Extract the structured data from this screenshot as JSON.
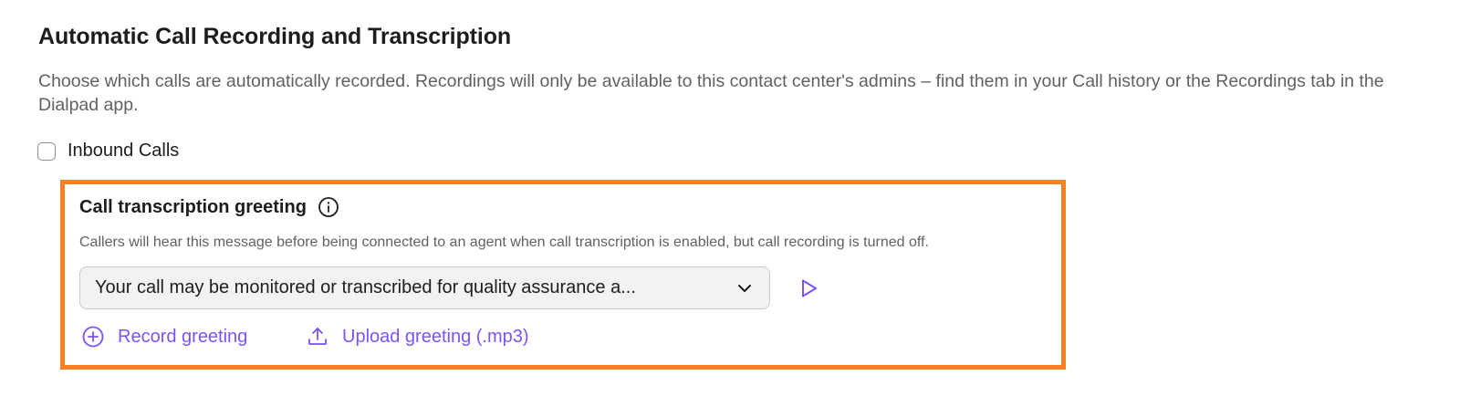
{
  "section": {
    "title": "Automatic Call Recording and Transcription",
    "description": "Choose which calls are automatically recorded. Recordings will only be available to this contact center's admins – find them in your Call history or the Recordings tab in the Dialpad app."
  },
  "inbound": {
    "label": "Inbound Calls",
    "checked": false
  },
  "greeting": {
    "title": "Call transcription greeting",
    "info_icon": "info-circle-icon",
    "description": "Callers will hear this message before being connected to an agent when call transcription is enabled, but call recording is turned off.",
    "selected_value": "Your call may be monitored or transcribed for quality assurance a...",
    "dropdown_icon": "chevron-down-icon",
    "play_icon": "play-icon",
    "record_label": "Record greeting",
    "record_icon": "plus-circle-icon",
    "upload_label": "Upload greeting (.mp3)",
    "upload_icon": "upload-icon"
  },
  "colors": {
    "accent": "#7c52ff",
    "highlight_border": "#f58025",
    "text_primary": "#1d1d1f",
    "text_secondary": "#5f6166",
    "select_bg": "#f2f2f4"
  }
}
